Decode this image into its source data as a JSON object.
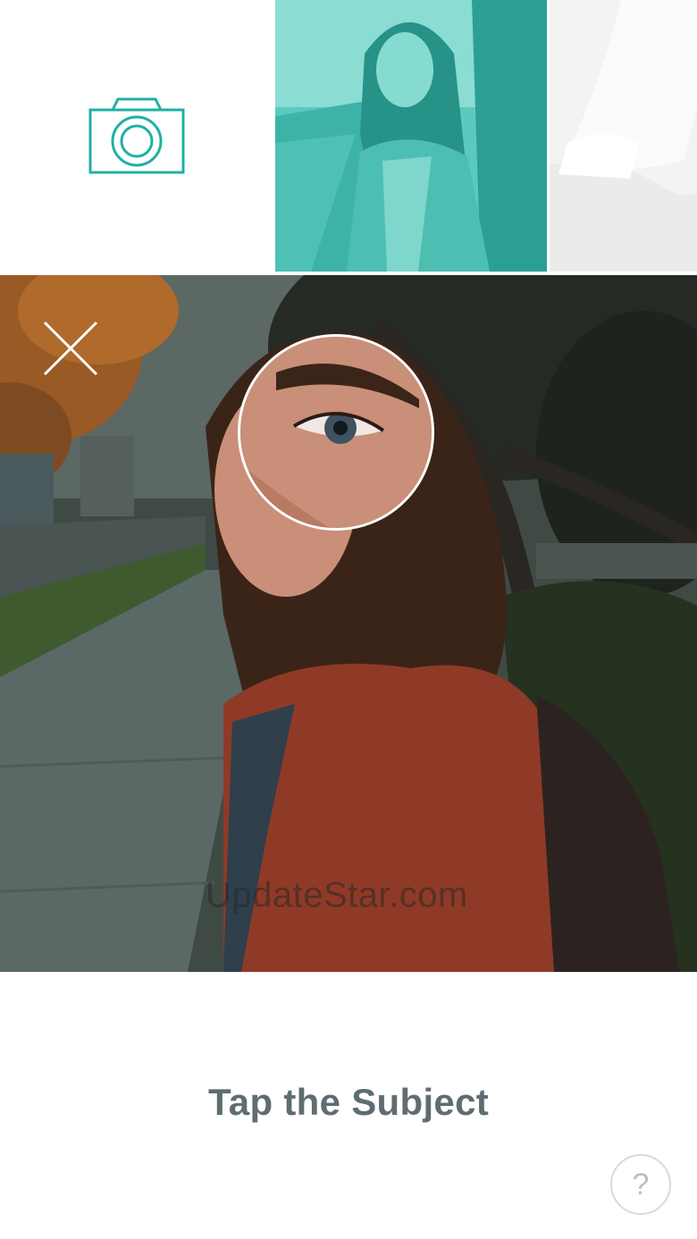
{
  "thumbnails": {
    "camera_icon": "camera-icon",
    "accent_color": "#1fb0a4",
    "items": [
      {
        "name": "teal-tinted-selfie"
      },
      {
        "name": "white-outfit-photo"
      }
    ]
  },
  "editor": {
    "close_icon": "close-icon",
    "watermark": "UpdateStar.com"
  },
  "footer": {
    "instruction": "Tap the Subject",
    "help_label": "?"
  }
}
